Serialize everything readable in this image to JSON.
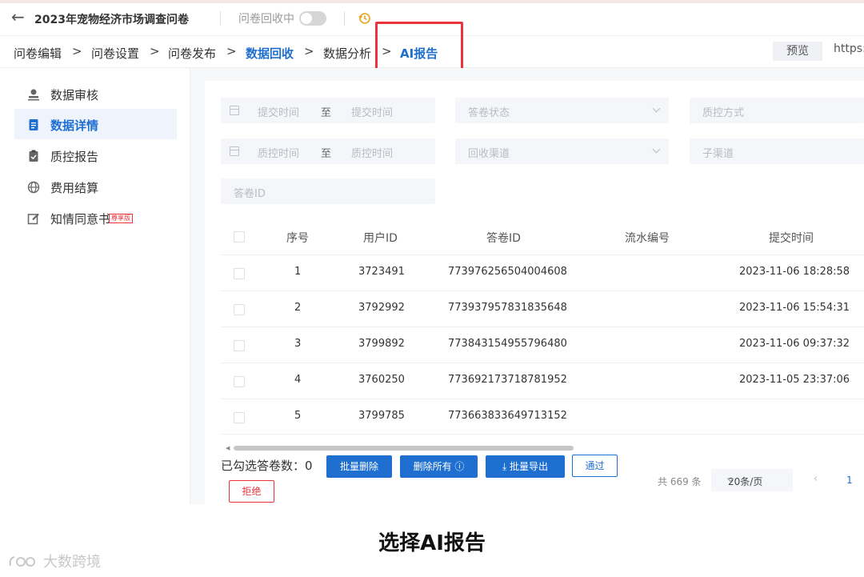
{
  "header": {
    "back_icon": "arrow-left-icon",
    "title": "2023年宠物经济市场调查问卷",
    "collecting_label": "问卷回收中",
    "collecting_on": false,
    "history_icon": "history-icon"
  },
  "nav": {
    "crumbs": [
      "问卷编辑",
      "问卷设置",
      "问卷发布",
      "数据回收",
      "数据分析",
      "AI报告"
    ],
    "active_crumb": "数据回收",
    "highlighted_crumb": "AI报告",
    "preview_label": "预览",
    "url_text": "https:/"
  },
  "sidebar": {
    "items": [
      {
        "label": "数据审核",
        "icon": "user-review-icon"
      },
      {
        "label": "数据详情",
        "icon": "document-icon",
        "active": true
      },
      {
        "label": "质控报告",
        "icon": "clipboard-check-icon"
      },
      {
        "label": "费用结算",
        "icon": "globe-icon"
      },
      {
        "label": "知情同意书",
        "icon": "edit-icon",
        "badge": "尊享版"
      }
    ]
  },
  "filters": {
    "submit_start_placeholder": "提交时间",
    "submit_end_placeholder": "提交时间",
    "range_separator": "至",
    "status_placeholder": "答卷状态",
    "qc_method_placeholder": "质控方式",
    "qc_start_placeholder": "质控时间",
    "qc_end_placeholder": "质控时间",
    "channel_placeholder": "回收渠道",
    "sub_channel_placeholder": "子渠道",
    "answer_id_placeholder": "答卷ID"
  },
  "table": {
    "columns": [
      "序号",
      "用户ID",
      "答卷ID",
      "流水编号",
      "提交时间"
    ],
    "rows": [
      {
        "index": "1",
        "user_id": "3723491",
        "answer_id": "773976256504004608",
        "serial": "",
        "submit_time": "2023-11-06 18:28:58"
      },
      {
        "index": "2",
        "user_id": "3792992",
        "answer_id": "773937957831835648",
        "serial": "",
        "submit_time": "2023-11-06 15:54:31"
      },
      {
        "index": "3",
        "user_id": "3799892",
        "answer_id": "773843154955796480",
        "serial": "",
        "submit_time": "2023-11-06 09:37:32"
      },
      {
        "index": "4",
        "user_id": "3760250",
        "answer_id": "773692173718781952",
        "serial": "",
        "submit_time": "2023-11-05 23:37:06"
      },
      {
        "index": "5",
        "user_id": "3799785",
        "answer_id": "773663833649713152",
        "serial": "",
        "submit_time": ""
      }
    ]
  },
  "footer": {
    "selected_label": "已勾选答卷数：0",
    "batch_delete": "批量删除",
    "delete_all": "删除所有 ⓘ",
    "batch_export": "⤓ 批量导出",
    "approve": "通过",
    "reject": "拒绝",
    "total": "共 669 条",
    "page_size": "20条/页",
    "prev": "‹",
    "current_page": "1"
  },
  "caption": "选择AI报告",
  "watermark": "大数跨境",
  "colors": {
    "accent": "#1f6fd1",
    "highlight_box": "#e8343a"
  }
}
